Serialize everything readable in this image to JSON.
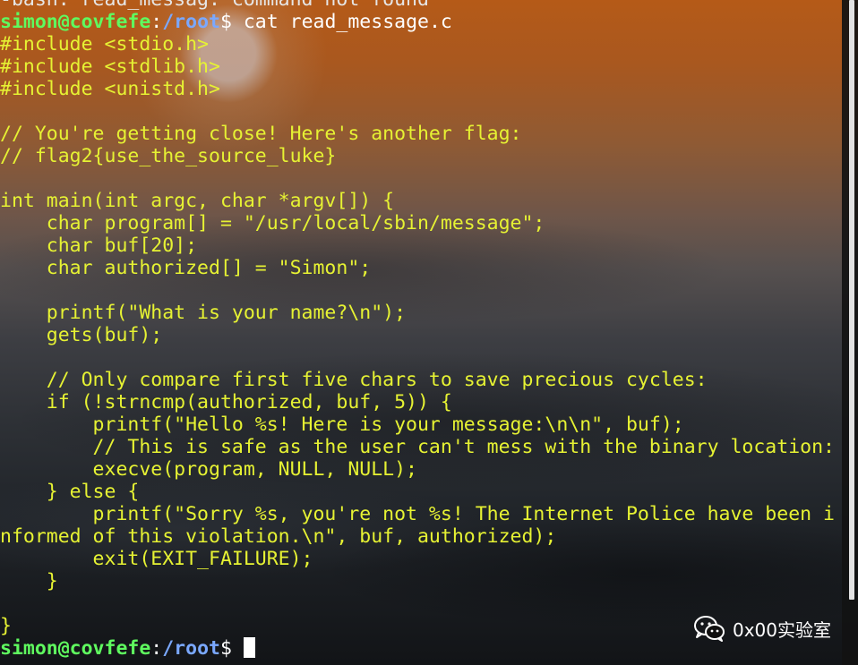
{
  "terminal": {
    "prompt": {
      "user_host": "simon@covfefe",
      "separator": ":",
      "path": "/root",
      "dollar": "$ "
    },
    "error_line": "-bash: read_messag: command not found",
    "command": "cat read_message.c",
    "code_lines": [
      "#include <stdio.h>",
      "#include <stdlib.h>",
      "#include <unistd.h>",
      "",
      "// You're getting close! Here's another flag:",
      "// flag2{use_the_source_luke}",
      "",
      "int main(int argc, char *argv[]) {",
      "    char program[] = \"/usr/local/sbin/message\";",
      "    char buf[20];",
      "    char authorized[] = \"Simon\";",
      "",
      "    printf(\"What is your name?\\n\");",
      "    gets(buf);",
      "",
      "    // Only compare first five chars to save precious cycles:",
      "    if (!strncmp(authorized, buf, 5)) {",
      "        printf(\"Hello %s! Here is your message:\\n\\n\", buf);",
      "        // This is safe as the user can't mess with the binary location:",
      "        execve(program, NULL, NULL);",
      "    } else {",
      "        printf(\"Sorry %s, you're not %s! The Internet Police have been i",
      "nformed of this violation.\\n\", buf, authorized);",
      "        exit(EXIT_FAILURE);",
      "    }",
      "",
      "}"
    ]
  },
  "watermark": {
    "icon": "wechat-icon",
    "text": "0x00实验室"
  },
  "colors": {
    "code_text": "#e6f233",
    "prompt_user": "#5ffa5f",
    "prompt_path": "#7aa8ff",
    "command_text": "#ffffff"
  }
}
